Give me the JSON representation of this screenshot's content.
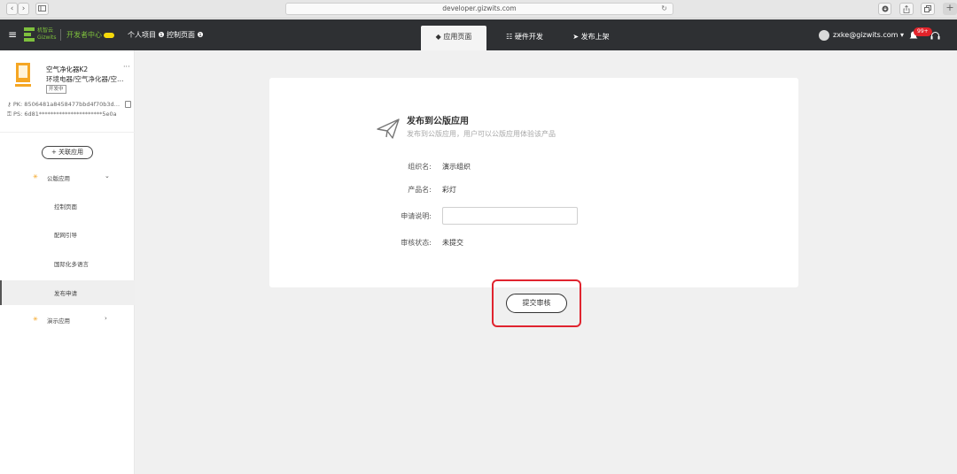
{
  "browser": {
    "url": "developer.gizwits.com",
    "back_icon": "‹",
    "forward_icon": "›"
  },
  "topnav": {
    "menu_icon": "≡",
    "brand_cn": "机智云",
    "brand_en": "Gizwits",
    "dev_center": "开发者中心",
    "personal_project": "个人项目",
    "control_page": "控制页面",
    "tabs": [
      {
        "label": "应用页面",
        "icon": "◆"
      },
      {
        "label": "硬件开发",
        "icon": "☷"
      },
      {
        "label": "发布上架",
        "icon": "➤"
      }
    ],
    "user_email": "zxke@gizwits.com",
    "notification_count": "99+"
  },
  "sidebar": {
    "product_name": "空气净化器K2",
    "more": "···",
    "product_category": "环境电器/空气净化器/空…",
    "product_status": "开发中",
    "pk_label": "PK:",
    "pk_value": "8506481a8458477bbd4f70b3d…",
    "ps_label": "PS:",
    "ps_value": "6d81**********************5e0a",
    "associate_button": "+ 关联应用",
    "menu": [
      {
        "label": "公版应用",
        "icon": "✳",
        "chevron": "⌄"
      },
      {
        "label": "控制页面"
      },
      {
        "label": "配网引导"
      },
      {
        "label": "国际化多语言"
      },
      {
        "label": "发布申请"
      },
      {
        "label": "演示应用",
        "icon": "✳",
        "chevron": "›"
      }
    ]
  },
  "main": {
    "title": "发布到公版应用",
    "subtitle": "发布到公版应用，用户可以公版应用体验该产品",
    "org_label": "组织名:",
    "org_value": "演示组织",
    "product_label": "产品名:",
    "product_value": "彩灯",
    "apply_label": "申请说明:",
    "apply_value": "",
    "status_label": "审核状态:",
    "status_value": "未提交",
    "submit_button": "提交审核"
  },
  "colors": {
    "nav_bg": "#2e3033",
    "accent_green": "#7ec03d",
    "highlight_red": "#e0242f",
    "badge_red": "#e2232a",
    "menu_icon_orange": "#f3a11b"
  }
}
